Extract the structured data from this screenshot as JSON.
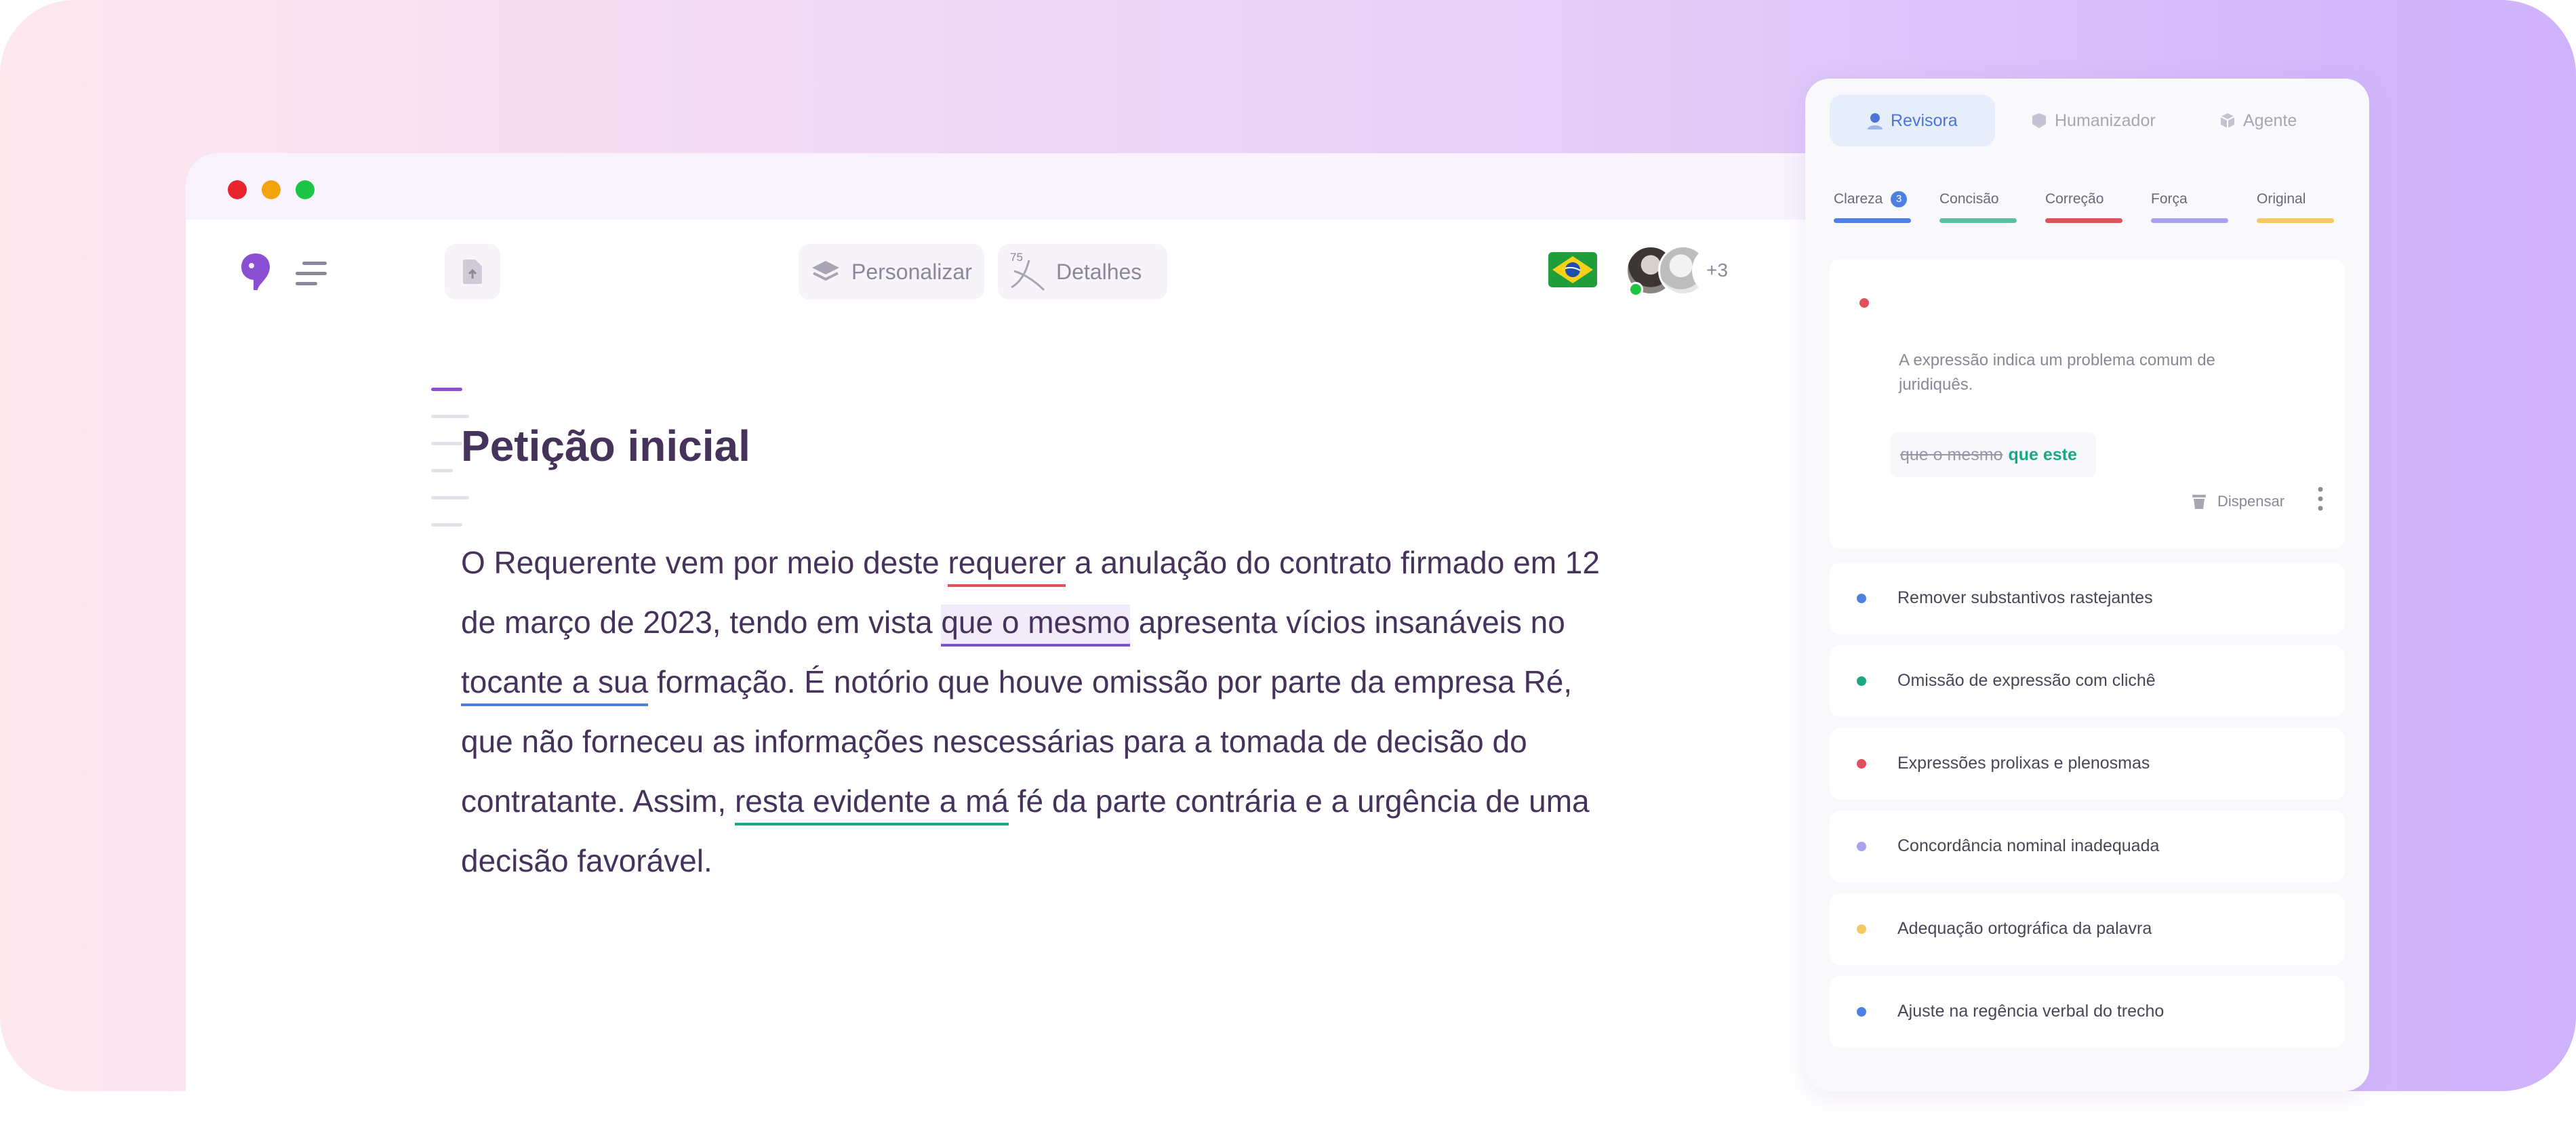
{
  "window_dots": {
    "red": "#e8242c",
    "yellow": "#f4a40c",
    "green": "#1cc544"
  },
  "toolbar": {
    "personalize_label": "Personalizar",
    "details_label": "Detalhes",
    "score_value": "75",
    "collab_count": "+3"
  },
  "document": {
    "title": "Petição inicial",
    "p_1": "O Requerente vem por meio deste ",
    "p_2": "requerer",
    "p_3": " a anulação do contrato firmado em 12 de março de 2023, tendo em vista ",
    "p_4": "que o mesmo",
    "p_5": " apresenta vícios insanáveis no ",
    "p_6": "tocante a sua",
    "p_7": " formação. É notório que houve omissão por parte da empresa Ré, que não forneceu as informações nescessárias para a tomada de decisão do contratante. Assim, ",
    "p_8": "resta evidente a má",
    "p_9": " fé da parte contrária e a urgência de uma decisão favorável."
  },
  "panel": {
    "tabs": [
      {
        "label": "Revisora",
        "active": true
      },
      {
        "label": "Humanizador",
        "active": false
      },
      {
        "label": "Agente",
        "active": false
      }
    ],
    "categories": [
      {
        "label": "Clareza",
        "badge": "3",
        "color": "#4e7fe2"
      },
      {
        "label": "Concisão",
        "color": "#5bc0a0"
      },
      {
        "label": "Correção",
        "color": "#e0505d"
      },
      {
        "label": "Força",
        "color": "#a9a2ee"
      },
      {
        "label": "Original",
        "color": "#f5c860"
      }
    ],
    "active_suggestion": {
      "dot_color": "#e0505d",
      "explanation": "A expressão indica um problema comum de juridiquês.",
      "original": "que o mesmo",
      "replacement": "que este",
      "dismiss_label": "Dispensar"
    },
    "suggestions": [
      {
        "label": "Remover substantivos rastejantes",
        "color": "#4e7fe2"
      },
      {
        "label": "Omissão de expressão com clichê",
        "color": "#19a883"
      },
      {
        "label": "Expressões prolixas e plenosmas",
        "color": "#e0505d"
      },
      {
        "label": "Concordância nominal inadequada",
        "color": "#a9a2ee"
      },
      {
        "label": "Adequação ortográfica da palavra",
        "color": "#f5c860"
      },
      {
        "label": "Ajuste na regência verbal do trecho",
        "color": "#4e7fe2"
      }
    ]
  }
}
